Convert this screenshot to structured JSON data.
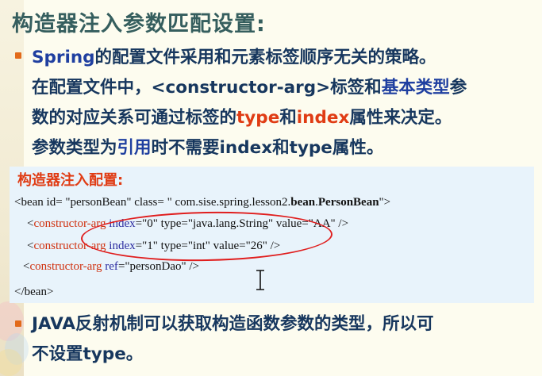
{
  "slide": {
    "title": "构造器注入参数匹配设置:",
    "bullet1": {
      "line1": [
        "Spring",
        "的配置文件采用和元素标签顺序无关的策略。"
      ],
      "line2_prefix": "在配置文件中，",
      "line2_tag": "<constructor-arg>",
      "line2_mid": "标签和",
      "line2_blue": "基本类型",
      "line2_end": "参",
      "line3_a": "数的对应关系可通过标签的",
      "line3_type": "type",
      "line3_and": "和",
      "line3_index": "index",
      "line3_end": "属性来决定。",
      "line4_a": "参数类型为",
      "line4_blue": "引用",
      "line4_b": "时不需要",
      "line4_index": "index",
      "line4_c": "和",
      "line4_type": "type",
      "line4_end": "属性。"
    },
    "code_title": "构造器注入配置:",
    "code": {
      "l1_a": "<bean id= \"personBean\" class= \" com.sise.spring.lesson2.",
      "l1_bold1": "bean",
      "l1_dot": ".",
      "l1_bold2": "PersonBean",
      "l1_end": "\">",
      "l2_open": "<",
      "l2_tag": "constructor-arg",
      "l2_attr": "index",
      "l2_rest": "=\"0\" type=\"java.lang.String\" value=\"AA\" />",
      "l3_open": "<",
      "l3_tag": "constructor-arg",
      "l3_attr": "index",
      "l3_rest": "=\"1\" type=\"int\" value=\"26\" />",
      "l4_open": "<",
      "l4_tag": "constructor-arg",
      "l4_attr": "ref",
      "l4_rest": "=\"personDao\" />",
      "l5": "</bean>"
    },
    "bullet2": {
      "line1_a": "JAVA",
      "line1_b": "反射机制可以获取构造函数参数的类型，所以可",
      "line2_a": "不设置",
      "line2_b": "type",
      "line2_c": "。"
    },
    "colors": {
      "title": "#355e5e",
      "text": "#17375e",
      "highlight_red": "#e03c14",
      "highlight_blue": "#1f3fa0",
      "code_bg": "#e8f3fb",
      "bullet": "#e26a1a",
      "annotation_ellipse": "#e01e1e"
    }
  }
}
